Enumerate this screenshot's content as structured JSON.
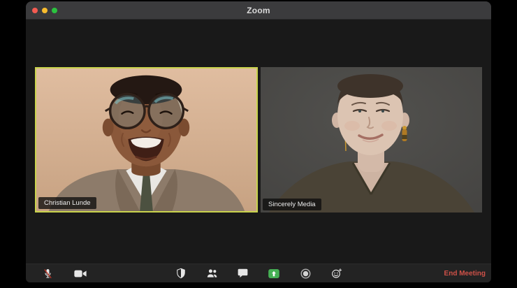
{
  "window": {
    "title": "Zoom",
    "traffic_lights": [
      {
        "name": "close",
        "color": "#f35b51"
      },
      {
        "name": "minimize",
        "color": "#f8bc2e"
      },
      {
        "name": "zoom",
        "color": "#2bc23f"
      }
    ]
  },
  "participants": [
    {
      "name": "Christian Lunde",
      "active_speaker": true
    },
    {
      "name": "Sincerely Media",
      "active_speaker": false
    }
  ],
  "toolbar": {
    "icons": [
      "microphone-muted-icon",
      "video-camera-icon",
      "security-shield-icon",
      "participants-icon",
      "chat-bubble-icon",
      "share-screen-icon",
      "record-icon",
      "reactions-icon"
    ],
    "end_meeting_label": "End Meeting"
  },
  "colors": {
    "active_speaker_border": "#c9d34c",
    "share_screen_green": "#45b054",
    "end_meeting_red": "#cf5148",
    "mute_slash_red": "#c0392b",
    "titlebar_bg": "#3b3b3d",
    "toolbar_bg": "#232323",
    "content_bg": "#191919"
  }
}
